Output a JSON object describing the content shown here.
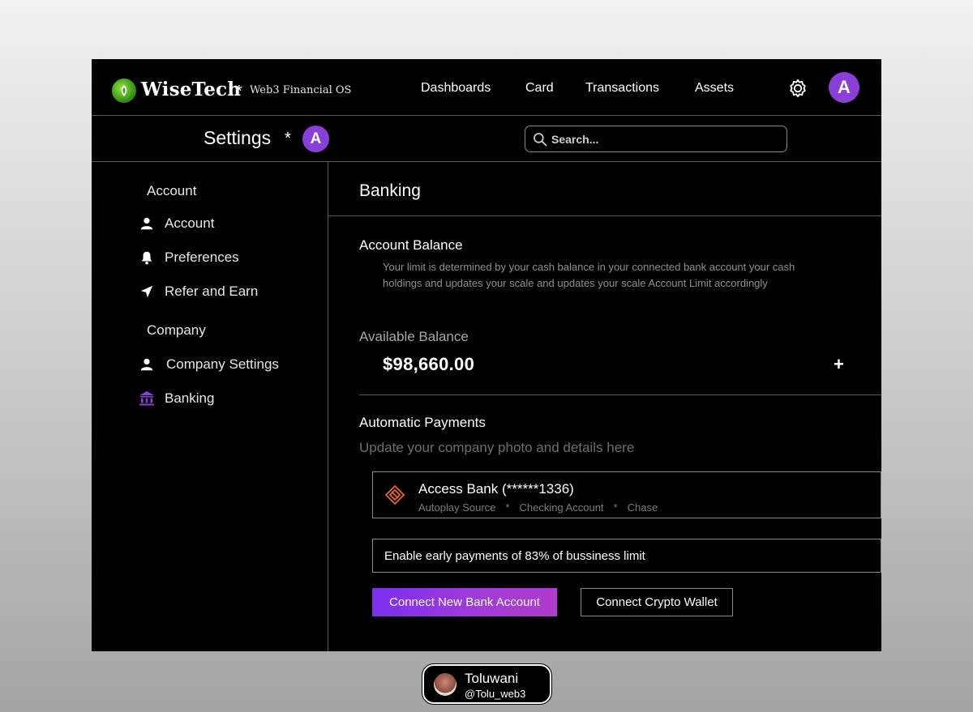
{
  "header": {
    "brand": "WiseTech",
    "separator": "*",
    "tagline": "Web3 Financial OS",
    "nav": [
      "Dashboards",
      "Card",
      "Transactions",
      "Assets"
    ],
    "avatar_initial": "A"
  },
  "subheader": {
    "title": "Settings",
    "separator": "*",
    "avatar_initial": "A",
    "search_placeholder": "Search..."
  },
  "sidebar": {
    "sections": [
      {
        "heading": "Account",
        "items": [
          {
            "label": "Account",
            "icon": "user-icon"
          },
          {
            "label": "Preferences",
            "icon": "bell-icon"
          },
          {
            "label": "Refer and Earn",
            "icon": "send-icon"
          }
        ]
      },
      {
        "heading": "Company",
        "items": [
          {
            "label": "Company Settings",
            "icon": "user-icon"
          },
          {
            "label": "Banking",
            "icon": "bank-icon",
            "active": true
          }
        ]
      }
    ]
  },
  "content": {
    "title": "Banking",
    "account_balance": {
      "title": "Account Balance",
      "description": "Your limit is determined by your cash balance in your connected bank account your cash holdings and updates your scale and updates your scale Account Limit accordingly"
    },
    "available_balance": {
      "label": "Available Balance",
      "amount": "$98,660.00",
      "add_symbol": "+"
    },
    "automatic_payments": {
      "title": "Automatic Payments",
      "description": "Update your company photo and details here",
      "bank": {
        "name": "Access Bank (******1336)",
        "meta": [
          "Autoplay Source",
          "*",
          "Checking Account",
          "*",
          "Chase"
        ]
      },
      "early_payments": "Enable early payments of 83% of bussiness limit"
    },
    "buttons": {
      "connect_bank": "Connect New Bank Account",
      "connect_wallet": "Connect Crypto Wallet"
    }
  },
  "credit": {
    "name": "Toluwani",
    "handle": "@Tolu_web3"
  },
  "colors": {
    "accent": "#8b3fd9",
    "background": "#000000",
    "border": "#5a5a5a",
    "muted_text": "#8f8f8f",
    "bank_logo": "#e8662a"
  }
}
